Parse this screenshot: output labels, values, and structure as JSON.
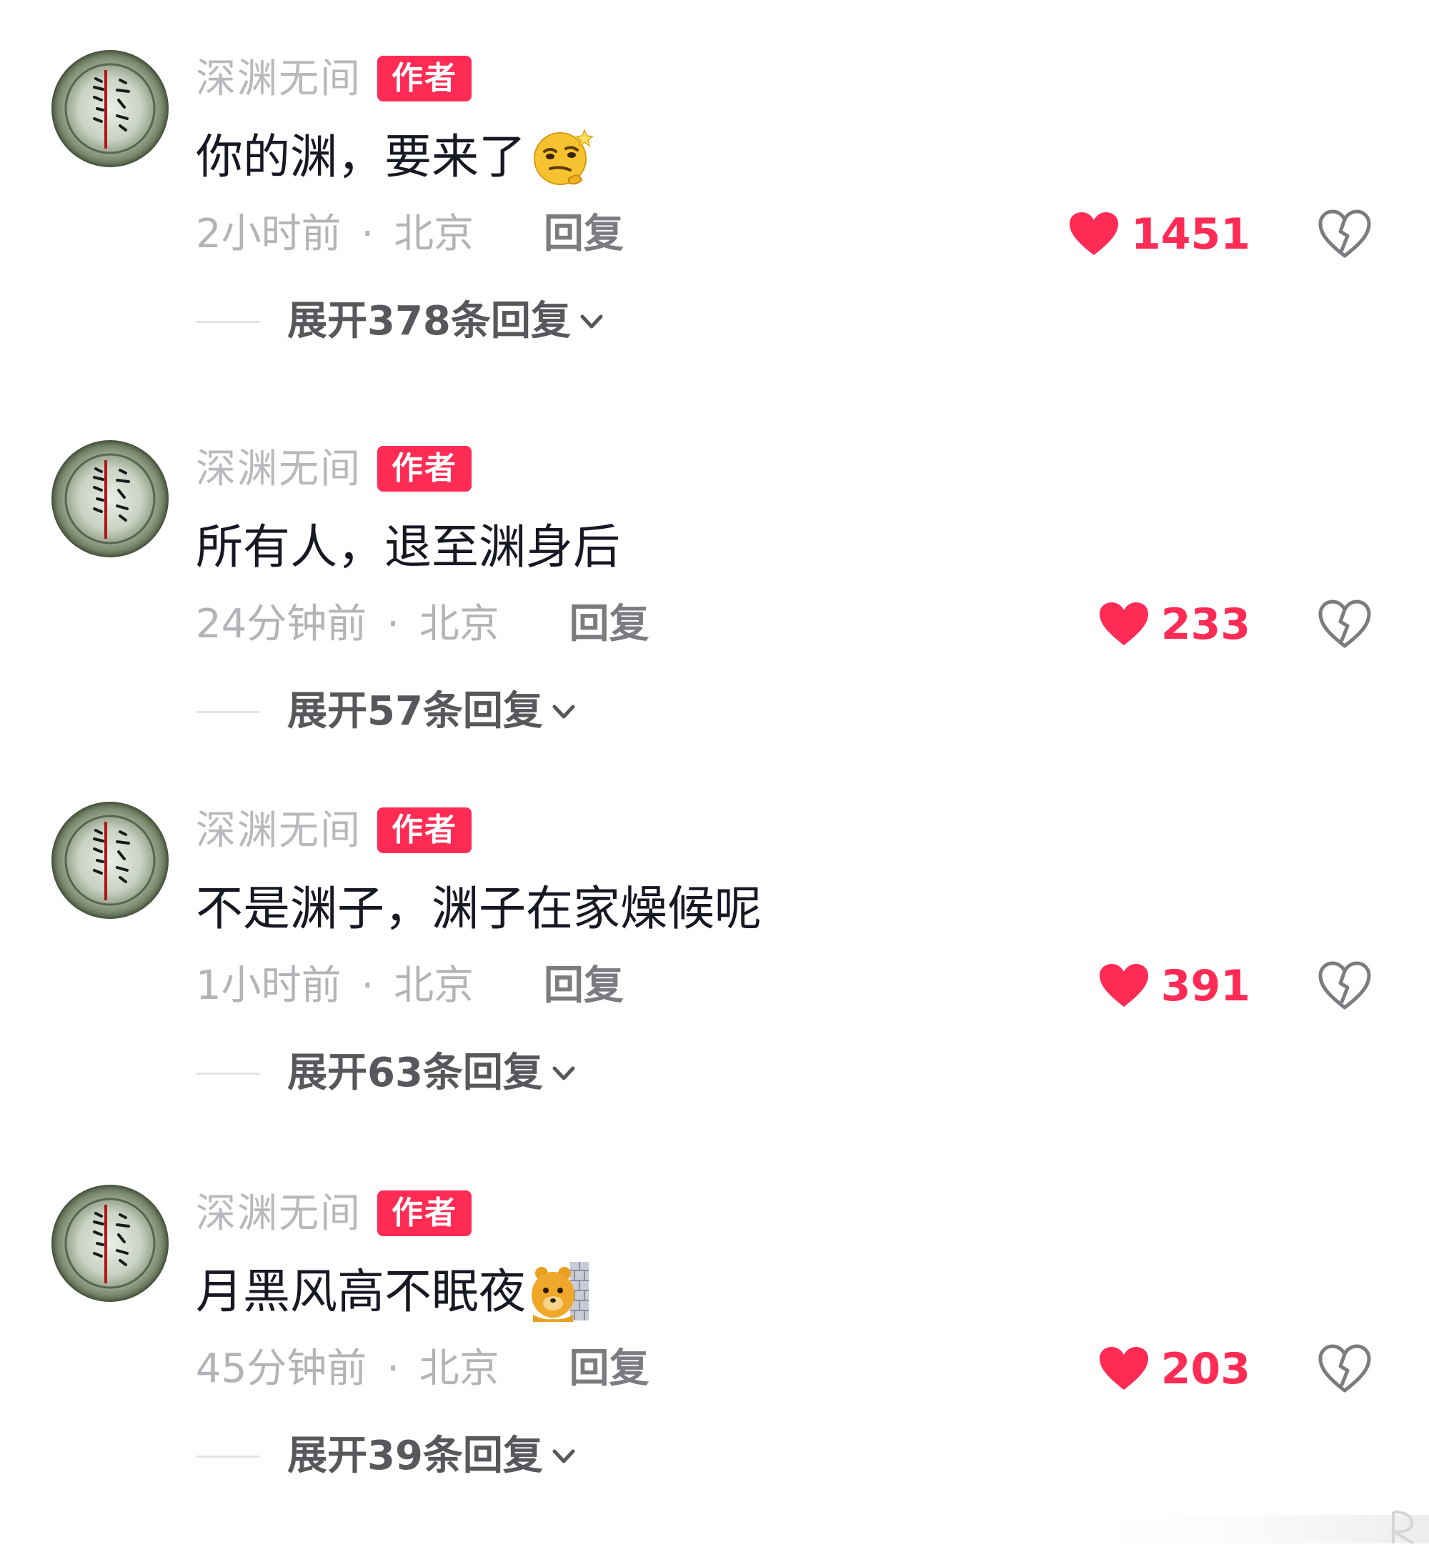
{
  "comments": [
    {
      "username": "深渊无间",
      "badge": "作者",
      "text": "你的渊，要来了",
      "emoji": "thinking-smirk-emoji",
      "time": "2小时前",
      "location": "北京",
      "reply": "回复",
      "likes": "1451",
      "expand": "展开378条回复"
    },
    {
      "username": "深渊无间",
      "badge": "作者",
      "text": "所有人，退至渊身后",
      "emoji": "",
      "time": "24分钟前",
      "location": "北京",
      "reply": "回复",
      "likes": "233",
      "expand": "展开57条回复"
    },
    {
      "username": "深渊无间",
      "badge": "作者",
      "text": "不是渊子，渊子在家燥候呢",
      "emoji": "",
      "time": "1小时前",
      "location": "北京",
      "reply": "回复",
      "likes": "391",
      "expand": "展开63条回复"
    },
    {
      "username": "深渊无间",
      "badge": "作者",
      "text": "月黑风高不眠夜",
      "emoji": "peeking-bear-wall-emoji",
      "time": "45分钟前",
      "location": "北京",
      "reply": "回复",
      "likes": "203",
      "expand": "展开39条回复"
    }
  ],
  "meta_separator": "·",
  "colors": {
    "accent": "#fe2c55",
    "username": "#b8b8bd",
    "comment_text": "#161823",
    "meta": "#b3b3b8",
    "expand": "#58585c"
  },
  "icons": {
    "like": "heart-icon",
    "dislike": "broken-heart-icon",
    "expand": "chevron-down-icon"
  }
}
